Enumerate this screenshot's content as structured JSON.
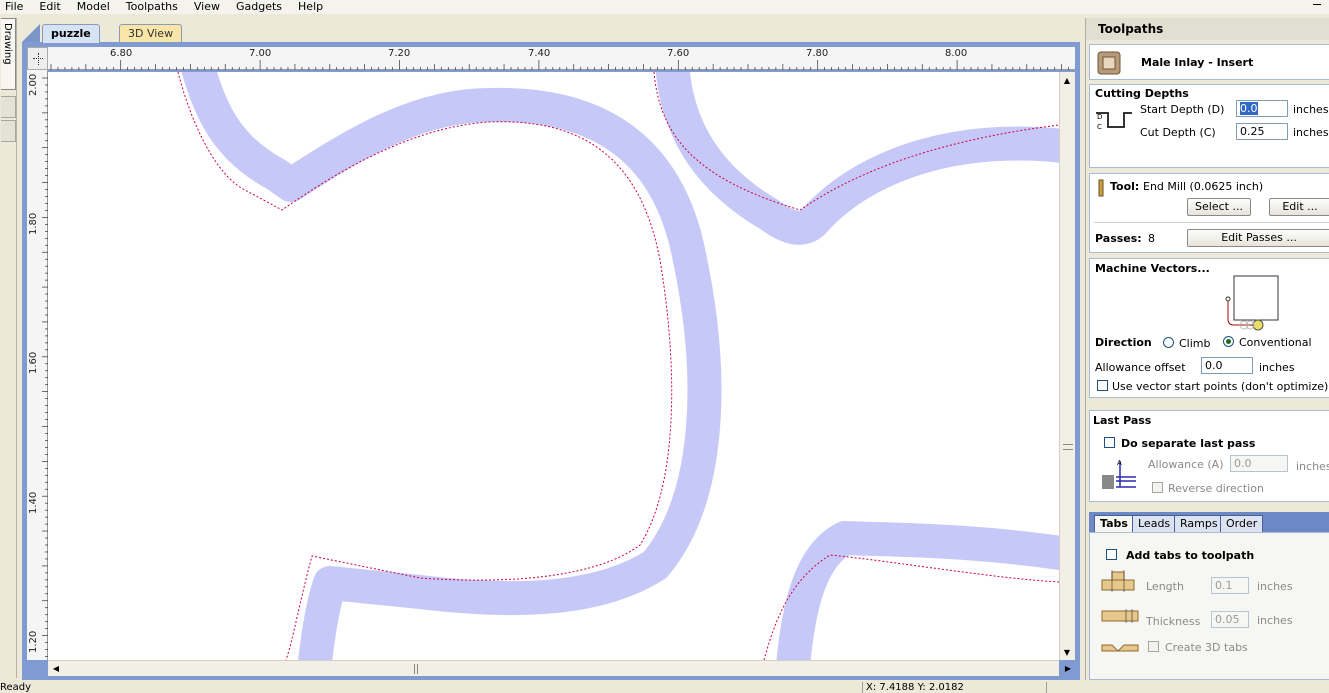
{
  "menu": [
    "File",
    "Edit",
    "Model",
    "Toolpaths",
    "View",
    "Gadgets",
    "Help"
  ],
  "side": {
    "drawing_tab": "Drawing"
  },
  "doc_tabs": {
    "active": "puzzle",
    "inactive": "3D View"
  },
  "ruler": {
    "h_labels": [
      "6.80",
      "7.00",
      "7.20",
      "7.40",
      "7.60",
      "7.80",
      "8.00"
    ],
    "v_labels": [
      "2.00",
      "1.80",
      "1.60",
      "1.40",
      "1.20"
    ]
  },
  "status": {
    "text": "Ready",
    "coords": "X: 7.4188 Y: 2.0182"
  },
  "panel": {
    "title": "Toolpaths",
    "toolpath_name": "Male Inlay - Insert",
    "cutting": {
      "heading": "Cutting Depths",
      "start_label": "Start Depth (D)",
      "start_value": "0.0",
      "cut_label": "Cut Depth (C)",
      "cut_value": "0.25",
      "unit": "inches"
    },
    "tool": {
      "label": "Tool:",
      "name": "End Mill (0.0625 inch)",
      "select_btn": "Select ...",
      "edit_btn": "Edit ...",
      "passes_label": "Passes:",
      "passes_value": "8",
      "edit_passes_btn": "Edit Passes ..."
    },
    "machine": {
      "heading": "Machine Vectors...",
      "direction_label": "Direction",
      "climb": "Climb",
      "conventional": "Conventional",
      "direction_selected": "Conventional",
      "allowance_label": "Allowance offset",
      "allowance_value": "0.0",
      "unit": "inches",
      "vector_start": "Use vector start points (don't optimize)"
    },
    "last_pass": {
      "heading": "Last Pass",
      "separate": "Do separate last pass",
      "allowance_label": "Allowance (A)",
      "allowance_value": "0.0",
      "unit": "inches",
      "reverse": "Reverse direction"
    },
    "tabs": {
      "items": [
        "Tabs",
        "Leads",
        "Ramps",
        "Order"
      ],
      "active": "Tabs",
      "add_tabs": "Add tabs to toolpath",
      "length_label": "Length",
      "length_value": "0.1",
      "thickness_label": "Thickness",
      "thickness_value": "0.05",
      "unit": "inches",
      "create_3d": "Create 3D tabs"
    }
  },
  "colors": {
    "toolpath": "#c6c8f8",
    "vector": "#cc0044",
    "frame": "#7f9bd2"
  }
}
